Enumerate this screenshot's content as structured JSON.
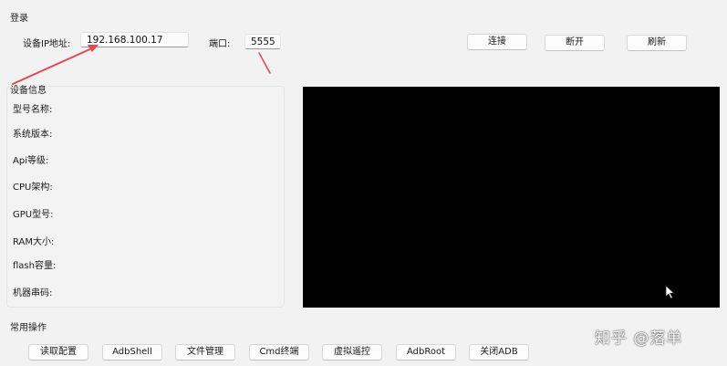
{
  "login": {
    "group_title": "登录",
    "ip_label": "设备IP地址:",
    "ip_value": "192.168.100.17",
    "port_label": "端口:",
    "port_value": "5555",
    "connect_label": "连接",
    "disconnect_label": "断开",
    "refresh_label": "刷新"
  },
  "device_info": {
    "group_title": "设备信息",
    "fields": [
      {
        "label": "型号名称:"
      },
      {
        "label": "系统版本:"
      },
      {
        "label": "Api等级:"
      },
      {
        "label": "CPU架构:"
      },
      {
        "label": "GPU型号:"
      },
      {
        "label": "RAM大小:"
      },
      {
        "label": "flash容量:"
      },
      {
        "label": "机器串码:"
      }
    ]
  },
  "common_ops": {
    "group_title": "常用操作",
    "buttons": [
      {
        "label": "读取配置"
      },
      {
        "label": "AdbShell"
      },
      {
        "label": "文件管理"
      },
      {
        "label": "Cmd终端"
      },
      {
        "label": "虚拟遥控"
      },
      {
        "label": "AdbRoot"
      },
      {
        "label": "关闭ADB"
      }
    ]
  },
  "watermark": "知乎 @落单",
  "colors": {
    "background": "#f2f2f2",
    "screen": "#000000",
    "annotation_arrow": "#e8474c"
  },
  "icons": {
    "cursor": "mouse-pointer-icon"
  }
}
